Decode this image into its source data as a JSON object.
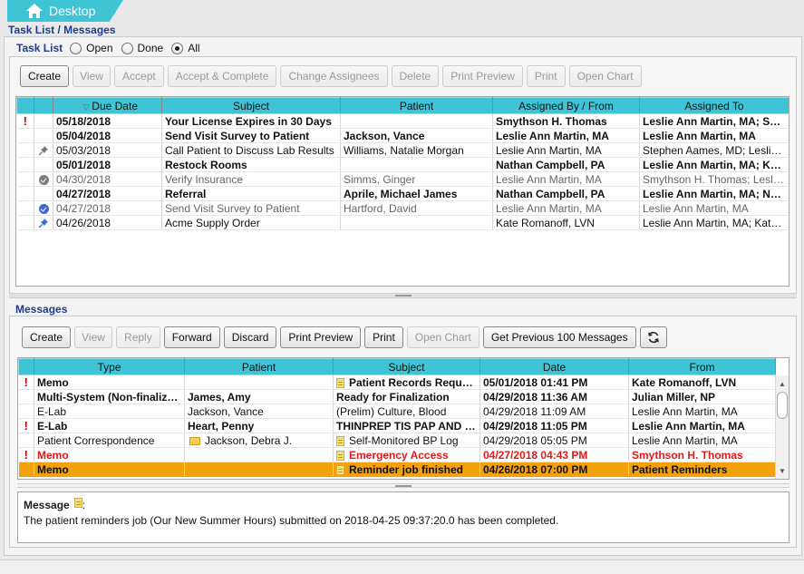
{
  "app": {
    "tab_label": "Desktop",
    "icon": "home-icon"
  },
  "task_list": {
    "section_title": "Task List / Messages",
    "filter_label": "Task List",
    "filter_options": [
      {
        "label": "Open",
        "checked": false
      },
      {
        "label": "Done",
        "checked": false
      },
      {
        "label": "All",
        "checked": true
      }
    ],
    "toolbar": [
      {
        "label": "Create",
        "enabled": true
      },
      {
        "label": "View",
        "enabled": false
      },
      {
        "label": "Accept",
        "enabled": false
      },
      {
        "label": "Accept & Complete",
        "enabled": false
      },
      {
        "label": "Change Assignees",
        "enabled": false
      },
      {
        "label": "Delete",
        "enabled": false
      },
      {
        "label": "Print Preview",
        "enabled": false
      },
      {
        "label": "Print",
        "enabled": false
      },
      {
        "label": "Open Chart",
        "enabled": false
      }
    ],
    "columns": [
      "",
      "",
      "Due Date",
      "Subject",
      "Patient",
      "Assigned By / From",
      "Assigned To"
    ],
    "sort_indicator": "▽",
    "rows": [
      {
        "flag": "exclamation",
        "status": "",
        "due": "05/18/2018",
        "subject": "Your License Expires in 30 Days",
        "patient": "",
        "by": "Smythson H. Thomas",
        "to": "Leslie Ann Martin, MA; Smy...",
        "style": "bold"
      },
      {
        "flag": "",
        "status": "",
        "due": "05/04/2018",
        "subject": "Send Visit Survey to Patient",
        "patient": "Jackson, Vance",
        "by": "Leslie Ann Martin, MA",
        "to": "Leslie Ann Martin, MA",
        "style": "bold"
      },
      {
        "flag": "",
        "status": "pin-gray",
        "due": "05/03/2018",
        "subject": "Call Patient to Discuss Lab Results",
        "patient": "Williams, Natalie Morgan",
        "by": "Leslie Ann Martin, MA",
        "to": "Stephen Aames, MD; Leslie...",
        "style": "normal"
      },
      {
        "flag": "",
        "status": "",
        "due": "05/01/2018",
        "subject": "Restock Rooms",
        "patient": "",
        "by": "Nathan Campbell, PA",
        "to": "Leslie Ann Martin, MA; Kate...",
        "style": "bold"
      },
      {
        "flag": "",
        "status": "check-gray",
        "due": "04/30/2018",
        "subject": "Verify Insurance",
        "patient": "Simms, Ginger",
        "by": "Leslie Ann Martin, MA",
        "to": "Smythson H. Thomas; Leslie...",
        "style": "gray"
      },
      {
        "flag": "",
        "status": "",
        "due": "04/27/2018",
        "subject": "Referral",
        "patient": "Aprile, Michael James",
        "by": "Nathan Campbell, PA",
        "to": "Leslie Ann Martin, MA; Nath...",
        "style": "bold"
      },
      {
        "flag": "",
        "status": "check-blue",
        "due": "04/27/2018",
        "subject": "Send Visit Survey to Patient",
        "patient": "Hartford, David",
        "by": "Leslie Ann Martin, MA",
        "to": "Leslie Ann Martin, MA",
        "style": "gray"
      },
      {
        "flag": "",
        "status": "pin-blue",
        "due": "04/26/2018",
        "subject": "Acme Supply Order",
        "patient": "",
        "by": "Kate Romanoff, LVN",
        "to": "Leslie Ann Martin, MA; Kate ...",
        "style": "normal"
      }
    ]
  },
  "messages": {
    "section_title": "Messages",
    "toolbar": [
      {
        "label": "Create",
        "enabled": true
      },
      {
        "label": "View",
        "enabled": false
      },
      {
        "label": "Reply",
        "enabled": false
      },
      {
        "label": "Forward",
        "enabled": true
      },
      {
        "label": "Discard",
        "enabled": true
      },
      {
        "label": "Print Preview",
        "enabled": true
      },
      {
        "label": "Print",
        "enabled": true
      },
      {
        "label": "Open Chart",
        "enabled": false
      },
      {
        "label": "Get Previous 100 Messages",
        "enabled": true
      }
    ],
    "refresh_icon": "refresh-icon",
    "columns": [
      "",
      "Type",
      "Patient",
      "Subject",
      "Date",
      "From"
    ],
    "rows": [
      {
        "flag": "exclamation",
        "type": "Memo",
        "patient": "",
        "patient_icon": "",
        "subject_icon": "note",
        "subject": "Patient Records Request",
        "date": "05/01/2018 01:41 PM",
        "from": "Kate Romanoff, LVN",
        "style": "bold"
      },
      {
        "flag": "",
        "type": "Multi-System (Non-finalized)",
        "patient": "James, Amy",
        "patient_icon": "",
        "subject_icon": "",
        "subject": "Ready for Finalization",
        "date": "04/29/2018 11:36 AM",
        "from": "Julian Miller, NP",
        "style": "bold"
      },
      {
        "flag": "",
        "type": "E-Lab",
        "patient": "Jackson, Vance",
        "patient_icon": "",
        "subject_icon": "",
        "subject": "(Prelim) Culture, Blood",
        "date": "04/29/2018 11:09 AM",
        "from": "Leslie Ann Martin, MA",
        "style": "normal"
      },
      {
        "flag": "exclamation",
        "type": "E-Lab",
        "patient": "Heart, Penny",
        "patient_icon": "",
        "subject_icon": "",
        "subject": "THINPREP TIS PAP AND C. ...",
        "date": "04/29/2018 11:05 PM",
        "from": "Leslie Ann Martin, MA",
        "style": "bold"
      },
      {
        "flag": "",
        "type": "Patient Correspondence",
        "patient": "Jackson, Debra J.",
        "patient_icon": "folder",
        "subject_icon": "note",
        "subject": "Self-Monitored BP Log",
        "date": "04/29/2018 05:05 PM",
        "from": "Leslie Ann Martin, MA",
        "style": "normal"
      },
      {
        "flag": "exclamation",
        "type": "Memo",
        "patient": "",
        "patient_icon": "",
        "subject_icon": "note",
        "subject": "Emergency Access",
        "date": "04/27/2018 04:43 PM",
        "from": "Smythson H. Thomas",
        "style": "red"
      },
      {
        "flag": "",
        "type": "Memo",
        "patient": "",
        "patient_icon": "",
        "subject_icon": "note",
        "subject": "Reminder job finished",
        "date": "04/26/2018 07:00 PM",
        "from": "Patient Reminders",
        "style": "selected"
      }
    ],
    "detail": {
      "label": "Message",
      "colon": ":",
      "text": "The patient reminders job (Our New Summer Hours) submitted on 2018-04-25 09:37:20.0 has been completed."
    }
  }
}
